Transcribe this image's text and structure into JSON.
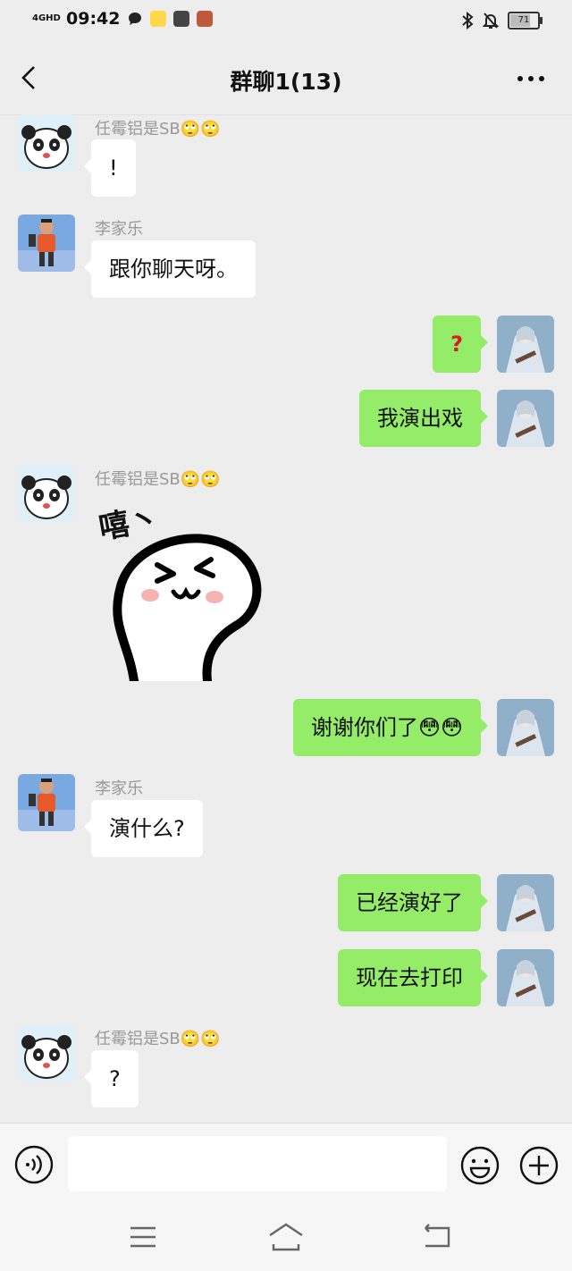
{
  "status": {
    "network": "4GHD",
    "time": "09:42",
    "battery": "71"
  },
  "header": {
    "title": "群聊1(13)"
  },
  "messages": [
    {
      "side": "in",
      "sender": "任霉铝是SB🙄🙄",
      "text": "!"
    },
    {
      "side": "in",
      "sender": "李家乐",
      "text": "跟你聊天呀。"
    },
    {
      "side": "out",
      "text": "?"
    },
    {
      "side": "out",
      "text": "我演出戏"
    },
    {
      "side": "in",
      "sender": "任霉铝是SB🙄🙄",
      "sticker_text": "嘻丶"
    },
    {
      "side": "out",
      "text": "谢谢你们了😳😳"
    },
    {
      "side": "in",
      "sender": "李家乐",
      "text": "演什么?"
    },
    {
      "side": "out",
      "text": "已经演好了"
    },
    {
      "side": "out",
      "text": "现在去打印"
    },
    {
      "side": "in",
      "sender": "任霉铝是SB🙄🙄",
      "text": "?"
    }
  ],
  "icons": {
    "back": "chevron-left-icon",
    "more": "more-dots-icon",
    "voice": "voice-icon",
    "emoji": "emoji-icon",
    "plus": "plus-icon"
  },
  "colors": {
    "outgoing_bubble": "#95ec69",
    "incoming_bubble": "#ffffff",
    "background": "#ededed"
  }
}
